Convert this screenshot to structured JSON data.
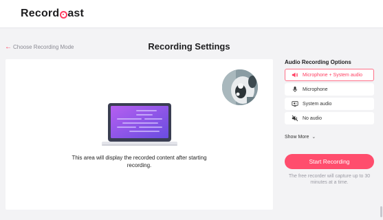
{
  "brand": {
    "name_before": "Record",
    "name_after": "ast",
    "accent": "#ff3d60"
  },
  "nav": {
    "back_label": "Choose Recording Mode",
    "back_icon": "arrow-left-icon"
  },
  "page": {
    "title": "Recording Settings"
  },
  "preview": {
    "message": "This area will display the recorded content after starting recording.",
    "webcam": "webcam-preview",
    "illustration": "laptop-illustration"
  },
  "audio": {
    "title": "Audio Recording Options",
    "selected_index": 0,
    "options": [
      {
        "label": "Microphone + System audio",
        "icon": "speaker-icon"
      },
      {
        "label": "Microphone",
        "icon": "microphone-icon"
      },
      {
        "label": "System audio",
        "icon": "monitor-audio-icon"
      },
      {
        "label": "No audio",
        "icon": "mute-icon"
      }
    ]
  },
  "show_more": {
    "label": "Show More",
    "icon": "chevron-down-icon"
  },
  "start": {
    "label": "Start Recording",
    "color": "#ff4d6d"
  },
  "note": {
    "text": "The free recorder will capture up to 30 minutes at a time."
  }
}
